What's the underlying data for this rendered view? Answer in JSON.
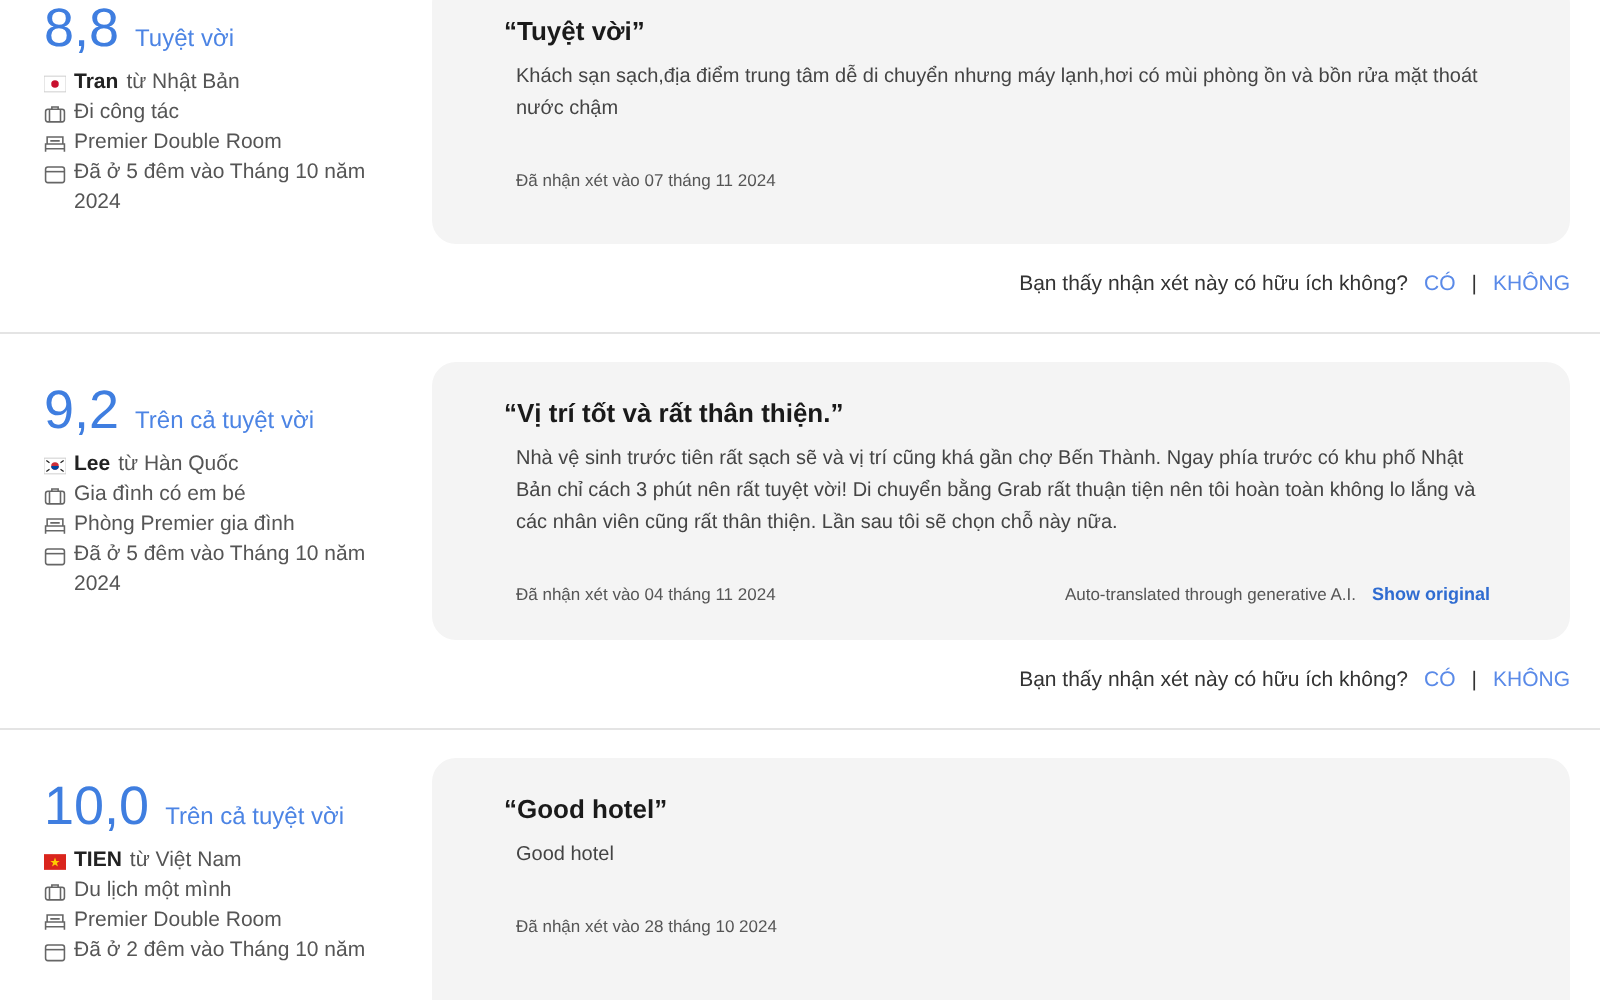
{
  "reviews": [
    {
      "score": "8,8",
      "score_label": "Tuyệt vời",
      "reviewer": {
        "flag": {
          "kind": "japan"
        },
        "name": "Tran",
        "origin": "từ Nhật Bản"
      },
      "trip_type": "Đi công tác",
      "room": "Premier Double Room",
      "stay": "Đã ở 5 đêm vào Tháng 10 năm 2024",
      "title": "“Tuyệt vời”",
      "body": "Khách sạn sạch,địa điểm trung tâm dễ di chuyển nhưng máy lạnh,hơi có mùi phòng ồn và bồn rửa mặt thoát nước chậm",
      "date": "Đã nhận xét vào 07 tháng 11 2024",
      "helpful": {
        "question": "Bạn thấy nhận xét này có hữu ích không?",
        "yes": "CÓ",
        "separator": "|",
        "no": "KHÔNG"
      }
    },
    {
      "score": "9,2",
      "score_label": "Trên cả tuyệt vời",
      "reviewer": {
        "flag": {
          "kind": "korea"
        },
        "name": "Lee",
        "origin": "từ Hàn Quốc"
      },
      "trip_type": "Gia đình có em bé",
      "room": "Phòng Premier gia đình",
      "stay": "Đã ở 5 đêm vào Tháng 10 năm 2024",
      "title": "“Vị trí tốt và rất thân thiện.”",
      "body": "Nhà vệ sinh trước tiên rất sạch sẽ và vị trí cũng khá gần chợ Bến Thành. Ngay phía trước có khu phố Nhật Bản chỉ cách 3 phút nên rất tuyệt vời! Di chuyển bằng Grab rất thuận tiện nên tôi hoàn toàn không lo lắng và các nhân viên cũng rất thân thiện. Lần sau tôi sẽ chọn chỗ này nữa.",
      "date": "Đã nhận xét vào 04 tháng 11 2024",
      "translation": {
        "note": "Auto-translated through generative A.I.",
        "link": "Show original"
      },
      "helpful": {
        "question": "Bạn thấy nhận xét này có hữu ích không?",
        "yes": "CÓ",
        "separator": "|",
        "no": "KHÔNG"
      }
    },
    {
      "score": "10,0",
      "score_label": "Trên cả tuyệt vời",
      "reviewer": {
        "flag": {
          "kind": "vietnam"
        },
        "name": "TIEN",
        "origin": "từ Việt Nam"
      },
      "trip_type": "Du lịch một mình",
      "room": "Premier Double Room",
      "stay": "Đã ở 2 đêm vào Tháng 10 năm",
      "title": "“Good hotel”",
      "body": "Good hotel",
      "date": "Đã nhận xét vào 28 tháng 10 2024"
    }
  ]
}
